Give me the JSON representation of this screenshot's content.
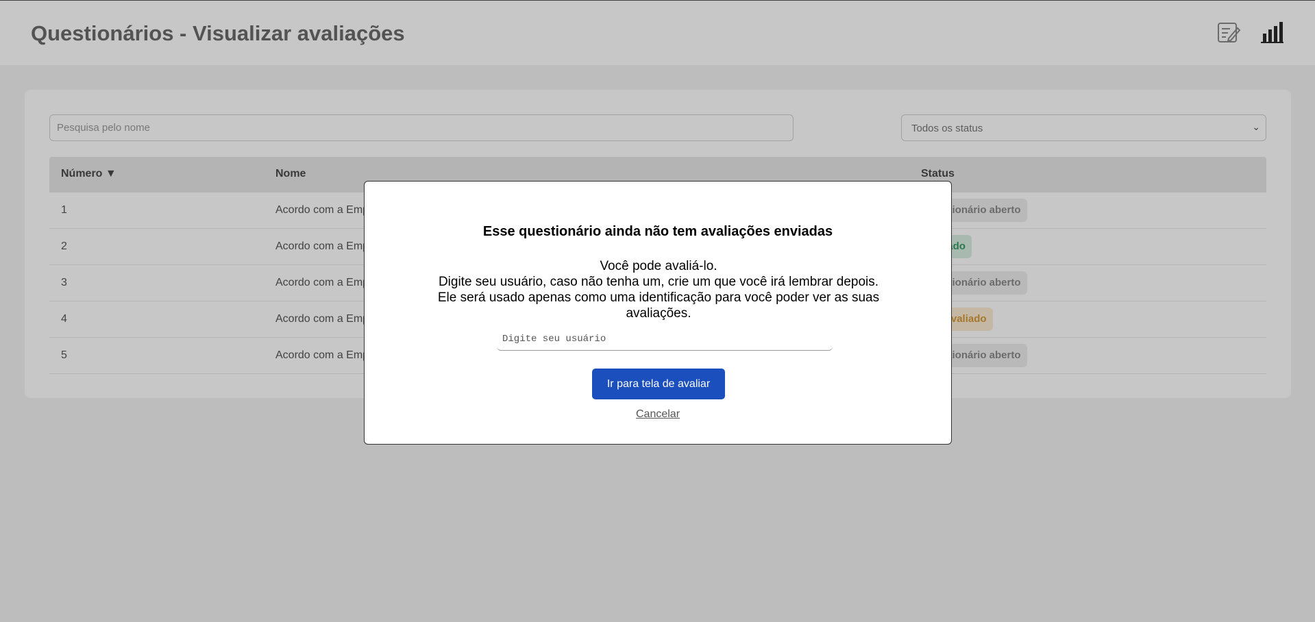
{
  "header": {
    "title": "Questionários - Visualizar avaliações",
    "icons": [
      "edit-icon",
      "bar-chart-icon"
    ]
  },
  "filters": {
    "search_placeholder": "Pesquisa pelo nome",
    "status_selected": "Todos os status"
  },
  "table": {
    "headers": {
      "number": "Número ▼",
      "name": "Nome",
      "status": "Status"
    },
    "rows": [
      {
        "number": "1",
        "name": "Acordo com a Emp",
        "status": "Questionário aberto"
      },
      {
        "number": "2",
        "name": "Acordo com a Emp",
        "status": "Avaliado"
      },
      {
        "number": "3",
        "name": "Acordo com a Emp",
        "status": "Questionário aberto"
      },
      {
        "number": "4",
        "name": "Acordo com a Emp",
        "status": "Não avaliado"
      },
      {
        "number": "5",
        "name": "Acordo com a Emp",
        "status": "Questionário aberto"
      }
    ]
  },
  "modal": {
    "title": "Esse questionário ainda não tem avaliações enviadas",
    "line1": "Você pode avaliá-lo.",
    "line2": "Digite seu usuário, caso não tenha um, crie um que você irá lembrar depois.",
    "line3": "Ele será usado apenas como uma identificação para você poder ver as suas avaliações.",
    "input_placeholder": "Digite seu usuário",
    "primary_button": "Ir para tela de avaliar",
    "cancel_link": "Cancelar"
  },
  "colors": {
    "primary": "#1a4fbd",
    "status_done": "#3c9a66",
    "status_pending": "#d49a3a",
    "overlay": "rgba(0,0,0,0.22)"
  }
}
